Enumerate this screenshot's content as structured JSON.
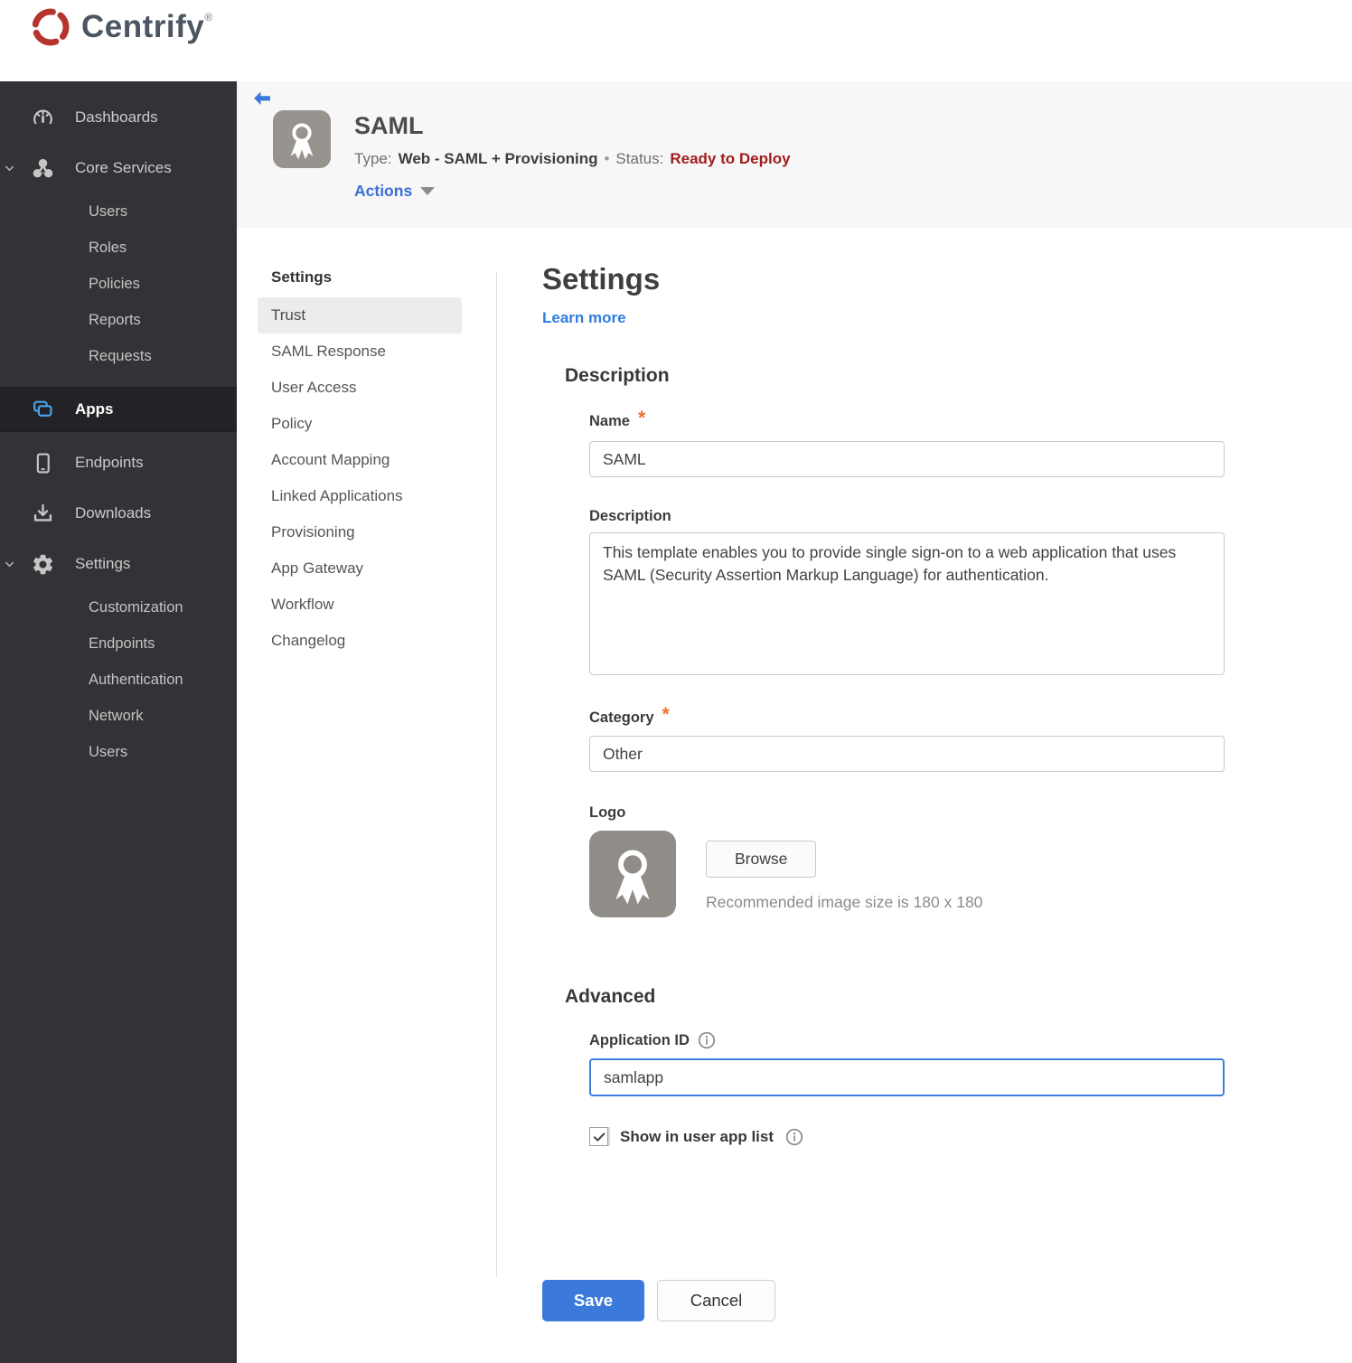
{
  "brand": {
    "name": "Centrify",
    "registered": "®"
  },
  "colors": {
    "sidebar_bg": "#333337",
    "sidebar_active_bg": "#232327",
    "apps_icon_blue": "#47a3e8",
    "header_band_bg": "#f7f7f7",
    "link_blue": "#2e7ce0",
    "actions_blue": "#3b6fd6",
    "status_red": "#a01d1d",
    "save_button_blue": "#3b7adb",
    "required_asterisk_orange": "#ef7133",
    "brand_swirl_red": "#b5342e"
  },
  "sidebar": {
    "items": [
      {
        "label": "Dashboards",
        "icon": "gauge-icon"
      },
      {
        "label": "Core Services",
        "icon": "core-services-icon",
        "expanded": true,
        "children": [
          "Users",
          "Roles",
          "Policies",
          "Reports",
          "Requests"
        ]
      },
      {
        "label": "Apps",
        "icon": "apps-icon",
        "active": true
      },
      {
        "label": "Endpoints",
        "icon": "tablet-icon"
      },
      {
        "label": "Downloads",
        "icon": "download-icon"
      },
      {
        "label": "Settings",
        "icon": "gear-icon",
        "expanded": true,
        "children": [
          "Customization",
          "Endpoints",
          "Authentication",
          "Network",
          "Users"
        ]
      }
    ]
  },
  "header": {
    "title": "SAML",
    "type_label": "Type:",
    "type_value": "Web - SAML + Provisioning",
    "separator": "•",
    "status_label": "Status:",
    "status_value": "Ready to Deploy",
    "actions_label": "Actions"
  },
  "subnav": {
    "heading": "Settings",
    "active_item": "Trust",
    "items": [
      "Trust",
      "SAML Response",
      "User Access",
      "Policy",
      "Account Mapping",
      "Linked Applications",
      "Provisioning",
      "App Gateway",
      "Workflow",
      "Changelog"
    ]
  },
  "main": {
    "title": "Settings",
    "learn_more_label": "Learn more",
    "required_marker": "*",
    "description": {
      "heading": "Description",
      "name_label": "Name",
      "name_value": "SAML",
      "description_label": "Description",
      "description_value": "This template enables you to provide single sign-on to a web application that uses SAML (Security Assertion Markup Language) for authentication.",
      "category_label": "Category",
      "category_value": "Other",
      "logo_label": "Logo",
      "browse_label": "Browse",
      "logo_hint": "Recommended image size is 180 x 180"
    },
    "advanced": {
      "heading": "Advanced",
      "application_id_label": "Application ID",
      "application_id_value": "samlapp",
      "show_in_user_app_list_label": "Show in user app list",
      "show_in_user_app_list_checked": true
    },
    "buttons": {
      "save_label": "Save",
      "cancel_label": "Cancel"
    }
  }
}
